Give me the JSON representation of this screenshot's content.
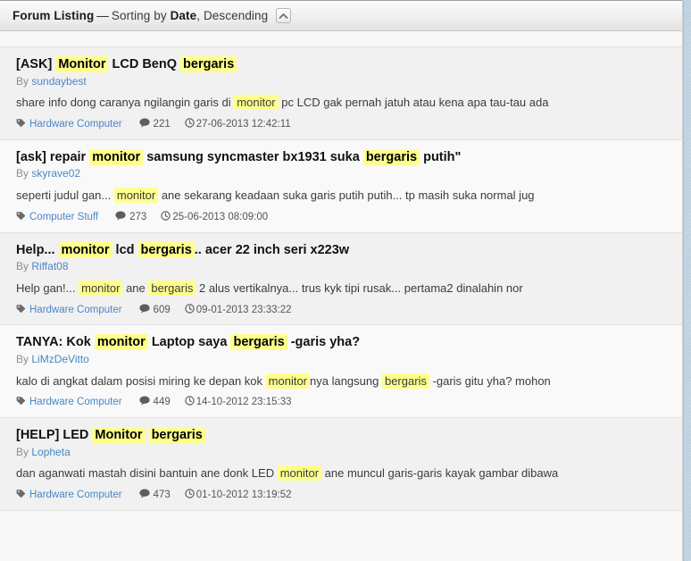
{
  "header": {
    "title_strong": "Forum Listing",
    "dash": "—",
    "sorting_prefix": "Sorting by",
    "sort_field": "Date",
    "comma": ",",
    "sort_direction": "Descending",
    "collapse_icon": "chevron-up-icon"
  },
  "icons": {
    "tag": "tag-icon",
    "comment": "comment-bubble-icon",
    "clock": "clock-icon"
  },
  "results": [
    {
      "title_parts": [
        {
          "text": "[ASK] ",
          "hl": false
        },
        {
          "text": "Monitor",
          "hl": true
        },
        {
          "text": " LCD BenQ ",
          "hl": false
        },
        {
          "text": "bergaris",
          "hl": true
        }
      ],
      "by_label": "By",
      "author": "sundaybest",
      "snippet_parts": [
        {
          "text": "share info dong caranya ngilangin garis di ",
          "hl": false
        },
        {
          "text": "monitor",
          "hl": true
        },
        {
          "text": " pc LCD gak pernah jatuh atau kena apa tau-tau ada",
          "hl": false
        }
      ],
      "category": "Hardware Computer",
      "replies": "221",
      "date": "27-06-2013 12:42:11"
    },
    {
      "title_parts": [
        {
          "text": "[ask] repair ",
          "hl": false
        },
        {
          "text": "monitor",
          "hl": true
        },
        {
          "text": " samsung syncmaster bx1931 suka ",
          "hl": false
        },
        {
          "text": "bergaris",
          "hl": true
        },
        {
          "text": " putih\"",
          "hl": false
        }
      ],
      "by_label": "By",
      "author": "skyrave02",
      "snippet_parts": [
        {
          "text": "seperti judul gan... ",
          "hl": false
        },
        {
          "text": "monitor",
          "hl": true
        },
        {
          "text": " ane sekarang keadaan suka garis putih putih... tp masih suka normal jug",
          "hl": false
        }
      ],
      "category": "Computer Stuff",
      "replies": "273",
      "date": "25-06-2013 08:09:00"
    },
    {
      "title_parts": [
        {
          "text": "Help... ",
          "hl": false
        },
        {
          "text": "monitor",
          "hl": true
        },
        {
          "text": " lcd ",
          "hl": false
        },
        {
          "text": "bergaris",
          "hl": true
        },
        {
          "text": ".. acer 22 inch seri x223w",
          "hl": false
        }
      ],
      "by_label": "By",
      "author": "Riffat08",
      "snippet_parts": [
        {
          "text": "Help gan!... ",
          "hl": false
        },
        {
          "text": "monitor",
          "hl": true
        },
        {
          "text": " ane ",
          "hl": false
        },
        {
          "text": "bergaris",
          "hl": true
        },
        {
          "text": " 2 alus vertikalnya... trus kyk tipi rusak... pertama2 dinalahin nor",
          "hl": false
        }
      ],
      "category": "Hardware Computer",
      "replies": "609",
      "date": "09-01-2013 23:33:22"
    },
    {
      "title_parts": [
        {
          "text": "TANYA: Kok ",
          "hl": false
        },
        {
          "text": "monitor",
          "hl": true
        },
        {
          "text": " Laptop saya ",
          "hl": false
        },
        {
          "text": "bergaris",
          "hl": true
        },
        {
          "text": " -garis yha?",
          "hl": false
        }
      ],
      "by_label": "By",
      "author": "LiMzDeVitto",
      "snippet_parts": [
        {
          "text": "kalo di angkat dalam posisi miring ke depan kok ",
          "hl": false
        },
        {
          "text": "monitor",
          "hl": true
        },
        {
          "text": "nya langsung ",
          "hl": false
        },
        {
          "text": "bergaris",
          "hl": true
        },
        {
          "text": " -garis gitu yha? mohon",
          "hl": false
        }
      ],
      "category": "Hardware Computer",
      "replies": "449",
      "date": "14-10-2012 23:15:33"
    },
    {
      "title_parts": [
        {
          "text": "[HELP] LED ",
          "hl": false
        },
        {
          "text": "Monitor",
          "hl": true
        },
        {
          "text": " ",
          "hl": false
        },
        {
          "text": "bergaris",
          "hl": true
        }
      ],
      "by_label": "By",
      "author": "Lopheta",
      "snippet_parts": [
        {
          "text": "dan aganwati mastah disini bantuin ane donk LED ",
          "hl": false
        },
        {
          "text": "monitor",
          "hl": true
        },
        {
          "text": " ane muncul garis-garis kayak gambar dibawa",
          "hl": false
        }
      ],
      "category": "Hardware Computer",
      "replies": "473",
      "date": "01-10-2012 13:19:52"
    }
  ],
  "colors": {
    "link": "#4a86c8",
    "highlight": "#ffff8c",
    "row_odd": "#f1f1f1",
    "row_even": "#f9f9f9",
    "text": "#3b3b3b"
  }
}
